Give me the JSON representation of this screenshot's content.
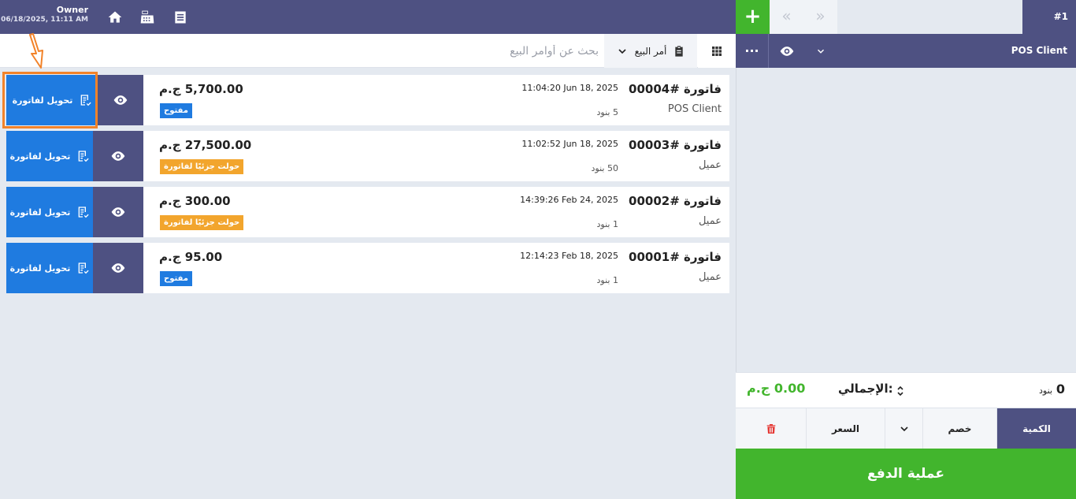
{
  "header": {
    "owner_name": "Owner",
    "datetime": "06/18/2025, 11:11 AM"
  },
  "icons": {
    "home": "home-icon",
    "register": "cash-register-icon",
    "list": "list-icon"
  },
  "cart_tabs": {
    "add_label": "+",
    "prev_label": "«",
    "next_label": "»",
    "current_tab": "#1"
  },
  "search": {
    "placeholder": "بحث عن أوامر البيع",
    "value": ""
  },
  "filter": {
    "selected": "أمر البيع"
  },
  "client_bar": {
    "more_label": "...",
    "client_name": "POS Client"
  },
  "orders": [
    {
      "invoice_no": "فاتورة #00004",
      "customer": "POS Client",
      "datetime": "11:04:20  Jun 18, 2025",
      "items": "5 بنود",
      "amount": "5,700.00 ج.م",
      "status": "مفتوح",
      "status_type": "open",
      "convert_label": "تحويل لفاتورة"
    },
    {
      "invoice_no": "فاتورة #00003",
      "customer": "عميل",
      "datetime": "11:02:52  Jun 18, 2025",
      "items": "50 بنود",
      "amount": "27,500.00 ج.م",
      "status": "حولت جزئيًا لفاتورة",
      "status_type": "partial",
      "convert_label": "تحويل لفاتورة"
    },
    {
      "invoice_no": "فاتورة #00002",
      "customer": "عميل",
      "datetime": "14:39:26  Feb 24, 2025",
      "items": "1 بنود",
      "amount": "300.00 ج.م",
      "status": "حولت جزئيًا لفاتورة",
      "status_type": "partial",
      "convert_label": "تحويل لفاتورة"
    },
    {
      "invoice_no": "فاتورة #00001",
      "customer": "عميل",
      "datetime": "12:14:23  Feb 18, 2025",
      "items": "1 بنود",
      "amount": "95.00 ج.م",
      "status": "مفتوح",
      "status_type": "open",
      "convert_label": "تحويل لفاتورة"
    }
  ],
  "cart": {
    "item_count": "0",
    "item_count_label": "بنود",
    "total_label": "الإجمالي:",
    "total_amount": "0.00 ج.م"
  },
  "actions": {
    "quantity": "الكمية",
    "discount": "خصم",
    "price": "السعر"
  },
  "pay_label": "عملية الدفع",
  "colors": {
    "primary": "#4e5182",
    "blue": "#1f7be0",
    "green": "#42b52d",
    "orange": "#f2a52d",
    "highlight": "#f2832a",
    "delete": "#e53935"
  }
}
